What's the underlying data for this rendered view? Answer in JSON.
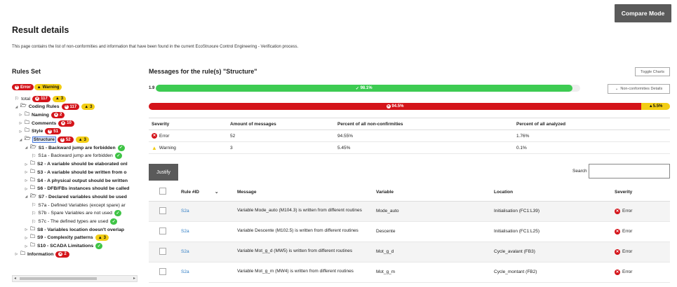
{
  "header": {
    "compare_mode_label": "Compare Mode",
    "title": "Result details",
    "description": "This page contains the list of non-conformities and information that have been found in the current EcoStruxure Control Engineering - Verification process."
  },
  "rules_set": {
    "title": "Rules Set",
    "legend": {
      "error_label": "Error",
      "warning_label": "Warning"
    },
    "tree": [
      {
        "label": "total",
        "bold": false,
        "level": 0,
        "type": "flag",
        "errors": "117",
        "warnings": "3",
        "selected": false,
        "ok": false
      },
      {
        "label": "Coding Rules",
        "bold": true,
        "level": 0,
        "type": "folder-open",
        "errors": "117",
        "warnings": "3",
        "selected": false,
        "ok": false
      },
      {
        "label": "Naming",
        "bold": true,
        "level": 1,
        "type": "folder",
        "errors": "2",
        "warnings": "",
        "selected": false,
        "ok": false
      },
      {
        "label": "Comments",
        "bold": true,
        "level": 1,
        "type": "folder",
        "errors": "10",
        "warnings": "",
        "selected": false,
        "ok": false
      },
      {
        "label": "Style",
        "bold": true,
        "level": 1,
        "type": "folder",
        "errors": "51",
        "warnings": "",
        "selected": false,
        "ok": false
      },
      {
        "label": "Structure",
        "bold": true,
        "level": 1,
        "type": "folder-open",
        "errors": "52",
        "warnings": "3",
        "selected": true,
        "ok": false
      },
      {
        "label": "S1 - Backward jump are forbidden",
        "bold": true,
        "level": 2,
        "type": "folder-open",
        "errors": "",
        "warnings": "",
        "selected": false,
        "ok": true
      },
      {
        "label": "S1a - Backward jump are forbidden",
        "bold": false,
        "level": 3,
        "type": "flag",
        "errors": "",
        "warnings": "",
        "selected": false,
        "ok": true
      },
      {
        "label": "S2 - A variable should be elaborated onl",
        "bold": true,
        "level": 2,
        "type": "folder",
        "errors": "",
        "warnings": "",
        "selected": false,
        "ok": false
      },
      {
        "label": "S3 - A variable should be written from o",
        "bold": true,
        "level": 2,
        "type": "folder",
        "errors": "",
        "warnings": "",
        "selected": false,
        "ok": false
      },
      {
        "label": "S4 - A physical output should be written",
        "bold": true,
        "level": 2,
        "type": "folder",
        "errors": "",
        "warnings": "",
        "selected": false,
        "ok": false
      },
      {
        "label": "S6 - DFB/FBs instances should be called",
        "bold": true,
        "level": 2,
        "type": "folder",
        "errors": "",
        "warnings": "",
        "selected": false,
        "ok": false
      },
      {
        "label": "S7 - Declared variables should be used",
        "bold": true,
        "level": 2,
        "type": "folder-open",
        "errors": "",
        "warnings": "",
        "selected": false,
        "ok": false
      },
      {
        "label": "S7a - Defined Variables (except spare) ar",
        "bold": false,
        "level": 3,
        "type": "flag",
        "errors": "",
        "warnings": "",
        "selected": false,
        "ok": false
      },
      {
        "label": "S7b - Spare Variables are not used",
        "bold": false,
        "level": 3,
        "type": "flag",
        "errors": "",
        "warnings": "",
        "selected": false,
        "ok": true
      },
      {
        "label": "S7c - The defined types are used",
        "bold": false,
        "level": 3,
        "type": "flag",
        "errors": "",
        "warnings": "",
        "selected": false,
        "ok": true
      },
      {
        "label": "S8 - Variables location doesn't overlap",
        "bold": true,
        "level": 2,
        "type": "folder",
        "errors": "",
        "warnings": "",
        "selected": false,
        "ok": false
      },
      {
        "label": "S9 - Complexity patterns",
        "bold": true,
        "level": 2,
        "type": "folder",
        "errors": "",
        "warnings": "3",
        "selected": false,
        "ok": false
      },
      {
        "label": "S10 - SCADA Limitations",
        "bold": true,
        "level": 2,
        "type": "folder",
        "errors": "",
        "warnings": "",
        "selected": false,
        "ok": true
      },
      {
        "label": "Information",
        "bold": true,
        "level": 0,
        "type": "folder",
        "errors": "2",
        "warnings": "",
        "selected": false,
        "ok": false
      }
    ]
  },
  "messages": {
    "title": "Messages for the rule(s) \"Structure\"",
    "toggle_charts_label": "Toggle Charts",
    "nonconf_details_label": "Non-conformities Details",
    "bar1": {
      "left_label": "1.9",
      "green_percent": 98.1,
      "green_label": "98.1%"
    },
    "bar2": {
      "red_percent": 94.5,
      "red_label": "94.5%",
      "yellow_percent": 5.5,
      "yellow_label": "5.5%"
    },
    "summary": {
      "headers": [
        "Severity",
        "Amount of messages",
        "Percent of all non-confirmities",
        "Percent of all analyzed"
      ],
      "rows": [
        {
          "severity": "Error",
          "amount": "52",
          "pct_nc": "94.55%",
          "pct_all": "1.76%"
        },
        {
          "severity": "Warning",
          "amount": "3",
          "pct_nc": "5.45%",
          "pct_all": "0.1%"
        }
      ]
    },
    "justify_label": "Justify",
    "search_label": "Search :",
    "search_value": "",
    "table": {
      "headers": [
        "Rule #ID",
        "Message",
        "Variable",
        "Location",
        "Severity"
      ],
      "rows": [
        {
          "rule_id": "S2a",
          "message": "Variable Mode_auto (M104.3) is written from different routines",
          "variable": "Mode_auto",
          "location": "Initialisation (FC1:L39)",
          "severity": "Error"
        },
        {
          "rule_id": "S2a",
          "message": "Variable Descente (M102.5) is written from different routines",
          "variable": "Descente",
          "location": "Initialisation (FC1:L25)",
          "severity": "Error"
        },
        {
          "rule_id": "S2a",
          "message": "Variable Mot_g_d (MW5) is written from different routines",
          "variable": "Mot_g_d",
          "location": "Cycle_avalant (FB3)",
          "severity": "Error"
        },
        {
          "rule_id": "S2a",
          "message": "Variable Mot_g_m (MW4) is written from different routines",
          "variable": "Mot_g_m",
          "location": "Cycle_montant (FB2)",
          "severity": "Error"
        }
      ]
    }
  }
}
